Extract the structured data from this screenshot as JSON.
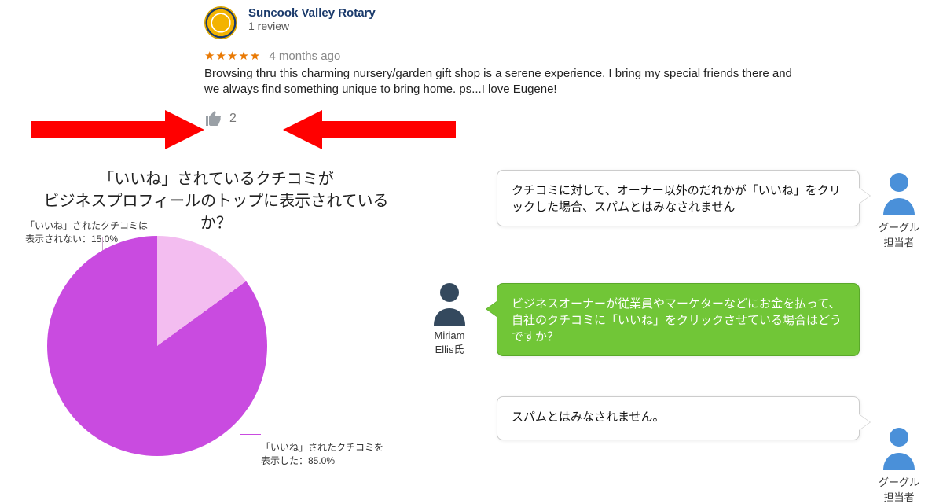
{
  "review": {
    "name": "Suncook Valley Rotary",
    "sub": "1 review",
    "stars": "★★★★★",
    "age": "4 months ago",
    "body": "Browsing thru this charming nursery/garden gift shop is a serene experience.  I bring my special friends there and we always find something unique to bring home.  ps...I love Eugene!",
    "like_count": "2"
  },
  "chart_title_l1": "「いいね」されているクチコミが",
  "chart_title_l2": "ビジネスプロフィールのトップに表示されているか？",
  "pie_label_top": "「いいね」されたクチコミは\n表示されない：15.0%",
  "pie_label_bot": "「いいね」されたクチコミを\n表示した：85.0%",
  "chart_data": {
    "type": "pie",
    "title": "「いいね」されているクチコミがビジネスプロフィールのトップに表示されているか？",
    "series": [
      {
        "name": "「いいね」されたクチコミは表示されない",
        "value": 15.0
      },
      {
        "name": "「いいね」されたクチコミを表示した",
        "value": 85.0
      }
    ]
  },
  "speech1": "クチコミに対して、オーナー以外のだれかが「いいね」をクリックした場合、スパムとはみなされません",
  "speech2": "ビジネスオーナーが従業員やマーケターなどにお金を払って、自社のクチコミに「いいね」をクリックさせている場合はどうですか？",
  "speech3": "スパムとはみなされません。",
  "persons": {
    "google": "グーグル\n担当者",
    "miriam": "Miriam\nEllis氏"
  },
  "colors": {
    "arrow": "#ff0000",
    "pie_major": "#c94be0",
    "pie_minor": "#f3bdf0",
    "green": "#71c637",
    "person_dark": "#34495e",
    "person_blue": "#4a90d9"
  }
}
